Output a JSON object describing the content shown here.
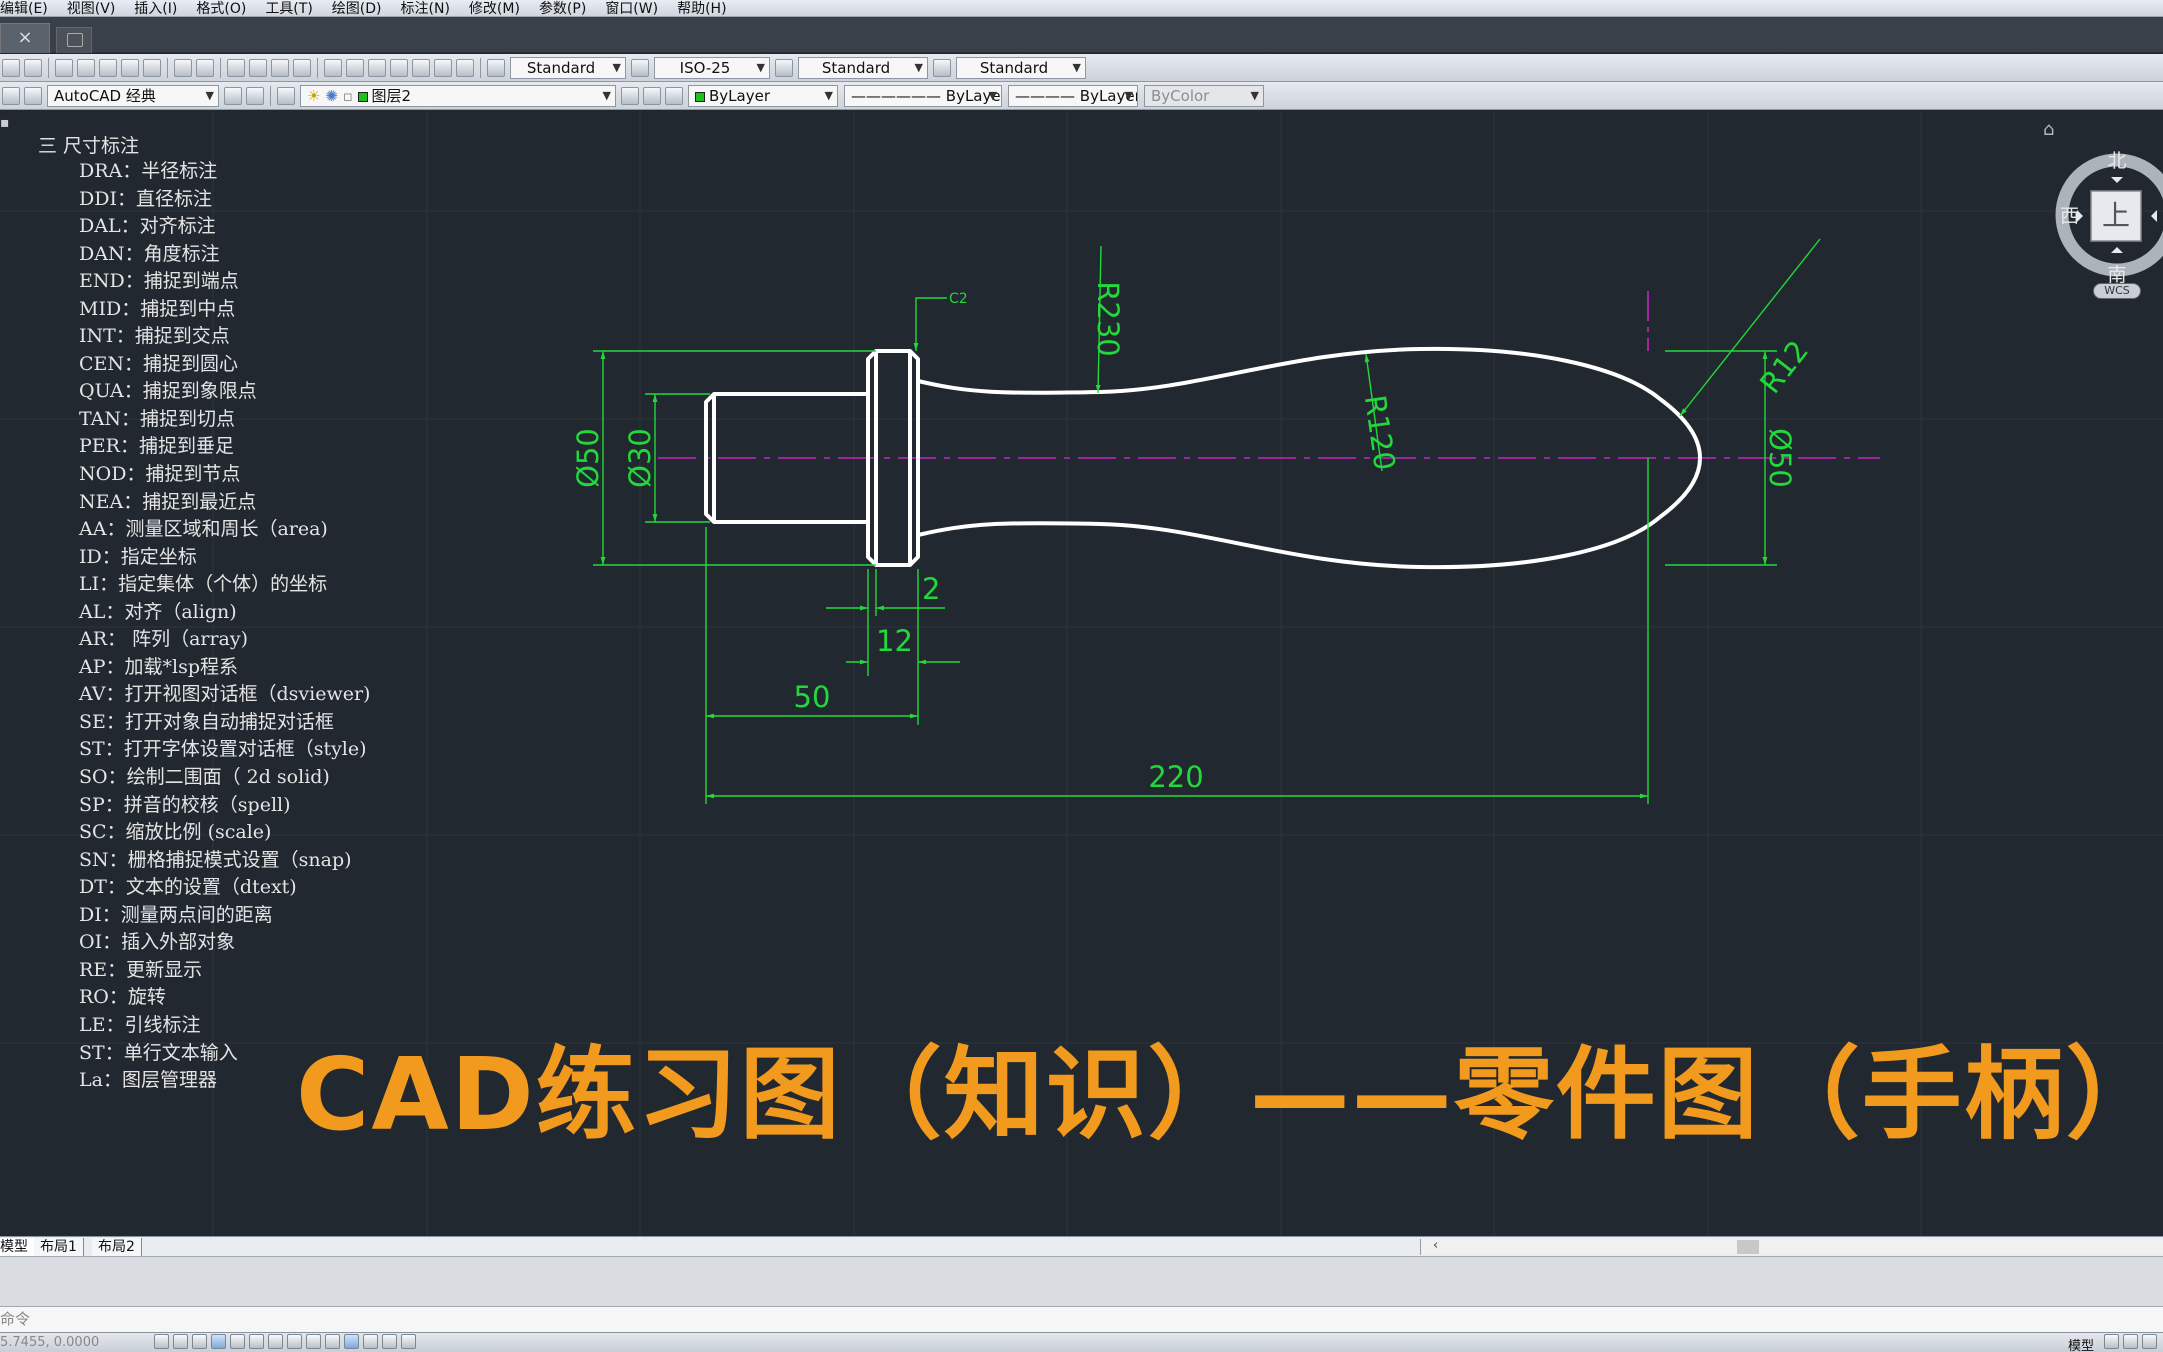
{
  "menu": [
    "编辑(E)",
    "视图(V)",
    "插入(I)",
    "格式(O)",
    "工具(T)",
    "绘图(D)",
    "标注(N)",
    "修改(M)",
    "参数(P)",
    "窗口(W)",
    "帮助(H)"
  ],
  "tabs": {
    "close_glyph": "×"
  },
  "toolbar1": {
    "text_style": "Standard",
    "dim_style": "ISO-25",
    "table_style": "Standard",
    "mleader_style": "Standard"
  },
  "toolbar2": {
    "workspace": "AutoCAD 经典",
    "layer": "图层2",
    "color": "ByLayer",
    "linetype": "ByLayer",
    "lineweight": "ByLayer",
    "plotstyle": "ByColor"
  },
  "notes": {
    "header": "三 尺寸标注",
    "items": [
      "DRA：半径标注",
      "DDI：直径标注",
      "DAL：对齐标注",
      "DAN：角度标注",
      "END：捕捉到端点",
      "MID：捕捉到中点",
      "INT：捕捉到交点",
      "CEN：捕捉到圆心",
      "QUA：捕捉到象限点",
      "TAN：捕捉到切点",
      "PER：捕捉到垂足",
      "NOD：捕捉到节点",
      "NEA：捕捉到最近点",
      "AA：测量区域和周长（area)",
      "ID：指定坐标",
      "LI：指定集体（个体）的坐标",
      "AL：对齐（align)",
      "AR： 阵列（array)",
      "AP：加载*lsp程系",
      "AV：打开视图对话框（dsviewer)",
      "SE：打开对象自动捕捉对话框",
      "ST：打开字体设置对话框（style)",
      "SO：绘制二围面（ 2d solid)",
      "SP：拼音的校核（spell)",
      "SC：缩放比例 (scale)",
      "SN：栅格捕捉模式设置（snap)",
      "DT：文本的设置（dtext)",
      "DI：测量两点间的距离",
      "OI：插入外部对象",
      "RE：更新显示",
      "RO：旋转",
      "LE：引线标注",
      "ST：单行文本输入",
      "La：图层管理器"
    ]
  },
  "dimensions": {
    "dia50_left": "Ø50",
    "dia30": "Ø30",
    "chamfer": "C2",
    "r230": "R230",
    "r120": "R120",
    "r12": "R12",
    "dia50_right": "Ø50",
    "len2": "2",
    "len12": "12",
    "len50": "50",
    "len220": "220"
  },
  "viewcube": {
    "north": "北",
    "south": "南",
    "west": "西",
    "face": "上",
    "wcs": "WCS"
  },
  "title": "CAD练习图（知识）——零件图（手柄）",
  "layout_tabs": [
    "模型",
    "布局1",
    "布局2"
  ],
  "command_prompt": "命令",
  "status": {
    "coords": "5.7455, 0.0000",
    "model": "模型"
  },
  "colors": {
    "background": "#212830",
    "dimension": "#22d83a",
    "outline": "#ffffff",
    "centerline": "#c026c0",
    "title": "#f29a1e"
  }
}
